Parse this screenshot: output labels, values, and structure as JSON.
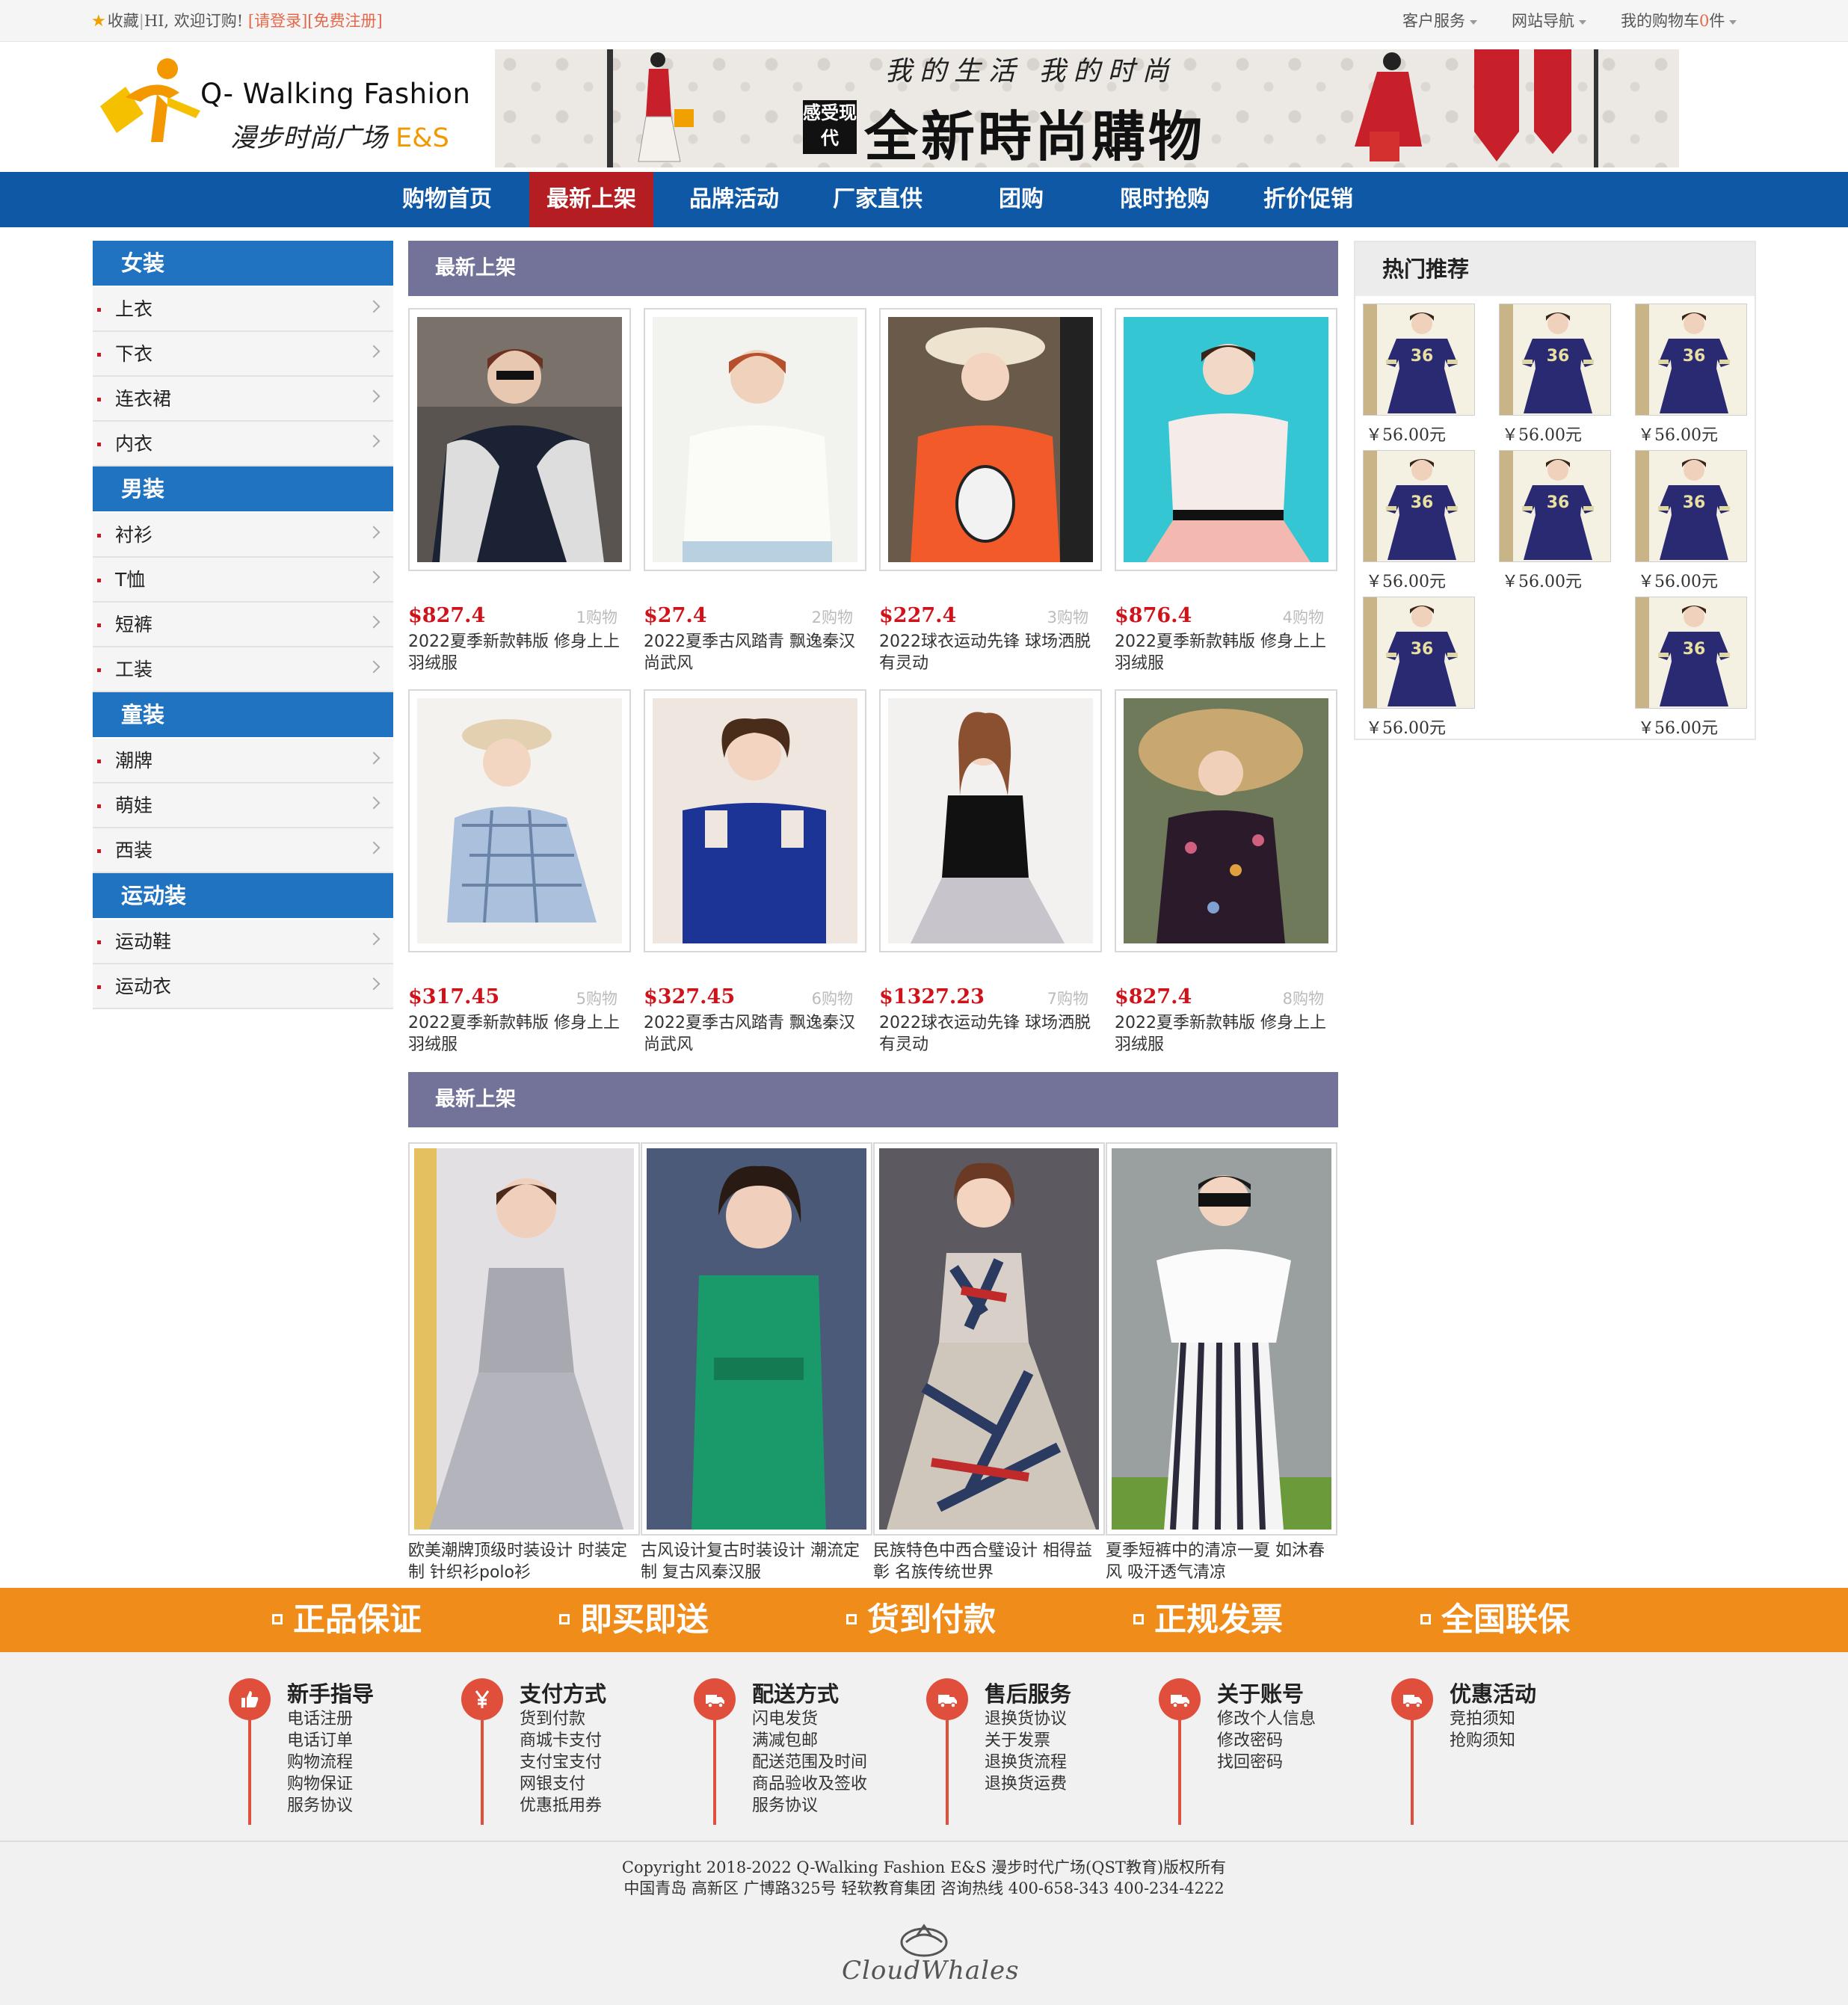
{
  "topbar": {
    "favorite": "收藏",
    "welcome": "HI, 欢迎订购!",
    "login": "[请登录]",
    "register": "[免费注册]",
    "customer_service": "客户服务",
    "site_nav": "网站导航",
    "cart_prefix": "我的购物车",
    "cart_count": "0",
    "cart_suffix": "件"
  },
  "logo": {
    "en": "Q- Walking Fashion",
    "cn": "漫步时尚广场",
    "es": "E&S"
  },
  "banner": {
    "slogan": "我的生活 我的时尚",
    "stamp": "感受现代",
    "headline": "全新時尚購物"
  },
  "nav": [
    "购物首页",
    "最新上架",
    "品牌活动",
    "厂家直供",
    "团购",
    "限时抢购",
    "折价促销"
  ],
  "nav_active": "最新上架",
  "sidebar": [
    {
      "title": "女装",
      "items": [
        "上衣",
        "下衣",
        "连衣裙",
        "内衣"
      ]
    },
    {
      "title": "男装",
      "items": [
        "衬衫",
        "T恤",
        "短裤",
        "工装"
      ]
    },
    {
      "title": "童装",
      "items": [
        "潮牌",
        "萌娃",
        "西装"
      ]
    },
    {
      "title": "运动装",
      "items": [
        "运动鞋",
        "运动衣"
      ]
    }
  ],
  "section1": {
    "title": "最新上架"
  },
  "products": [
    {
      "price": "$827.4",
      "buy": "1购物",
      "name": "2022夏季新款韩版 修身上上羽绒服"
    },
    {
      "price": "$27.4",
      "buy": "2购物",
      "name": "2022夏季古风踏青 飘逸秦汉尚武风"
    },
    {
      "price": "$227.4",
      "buy": "3购物",
      "name": "2022球衣运动先锋 球场洒脱有灵动"
    },
    {
      "price": "$876.4",
      "buy": "4购物",
      "name": "2022夏季新款韩版 修身上上羽绒服"
    },
    {
      "price": "$317.45",
      "buy": "5购物",
      "name": "2022夏季新款韩版 修身上上羽绒服"
    },
    {
      "price": "$327.45",
      "buy": "6购物",
      "name": "2022夏季古风踏青 飘逸秦汉尚武风"
    },
    {
      "price": "$1327.23",
      "buy": "7购物",
      "name": "2022球衣运动先锋 球场洒脱有灵动"
    },
    {
      "price": "$827.4",
      "buy": "8购物",
      "name": "2022夏季新款韩版 修身上上羽绒服"
    }
  ],
  "section2": {
    "title": "最新上架"
  },
  "big_products": [
    {
      "name": "欧美潮牌顶级时装设计 时装定制 针织衫polo衫"
    },
    {
      "name": "古风设计复古时装设计 潮流定制 复古风秦汉服"
    },
    {
      "name": "民族特色中西合璧设计 相得益彰 名族传统世界"
    },
    {
      "name": "夏季短裤中的清凉一夏 如沐春风 吸汗透气清凉"
    }
  ],
  "hot": {
    "title": "热门推荐",
    "items": [
      {
        "price": "￥56.00元"
      },
      {
        "price": "￥56.00元"
      },
      {
        "price": "￥56.00元"
      },
      {
        "price": "￥56.00元"
      },
      {
        "price": "￥56.00元"
      },
      {
        "price": "￥56.00元"
      },
      {
        "price": "￥56.00元"
      },
      {
        "price": "￥56.00元"
      }
    ]
  },
  "guarantees": [
    "正品保证",
    "即买即送",
    "货到付款",
    "正规发票",
    "全国联保"
  ],
  "help": [
    {
      "title": "新手指导",
      "icon": "thumbs-up-icon",
      "items": [
        "电话注册",
        "电话订单",
        "购物流程",
        "购物保证",
        "服务协议"
      ]
    },
    {
      "title": "支付方式",
      "icon": "yen-icon",
      "items": [
        "货到付款",
        "商城卡支付",
        "支付宝支付",
        "网银支付",
        "优惠抵用券"
      ]
    },
    {
      "title": "配送方式",
      "icon": "truck-icon",
      "items": [
        "闪电发货",
        "满减包邮",
        "配送范围及时间",
        "商品验收及签收",
        "服务协议"
      ]
    },
    {
      "title": "售后服务",
      "icon": "truck-icon",
      "items": [
        "退换货协议",
        "关于发票",
        "退换货流程",
        "退换货运费"
      ]
    },
    {
      "title": "关于账号",
      "icon": "truck-icon",
      "items": [
        "修改个人信息",
        "修改密码",
        "找回密码"
      ]
    },
    {
      "title": "优惠活动",
      "icon": "truck-icon",
      "items": [
        "竞拍须知",
        "抢购须知"
      ]
    }
  ],
  "footer": {
    "copyright": "Copyright 2018-2022 Q-Walking Fashion E&S 漫步时代广场(QST教育)版权所有",
    "address": "中国青岛 高新区 广博路325号 轻软教育集团 咨询热线 400-658-343 400-234-4222",
    "brand": "CloudWhales"
  },
  "colors": {
    "nav_bg": "#0e58a6",
    "nav_active": "#b41d22",
    "category_bg": "#1f73c0",
    "section_bg": "#737399",
    "price": "#d0121a",
    "guarantee_bg": "#f08c1a",
    "help_icon": "#e04f3c"
  }
}
